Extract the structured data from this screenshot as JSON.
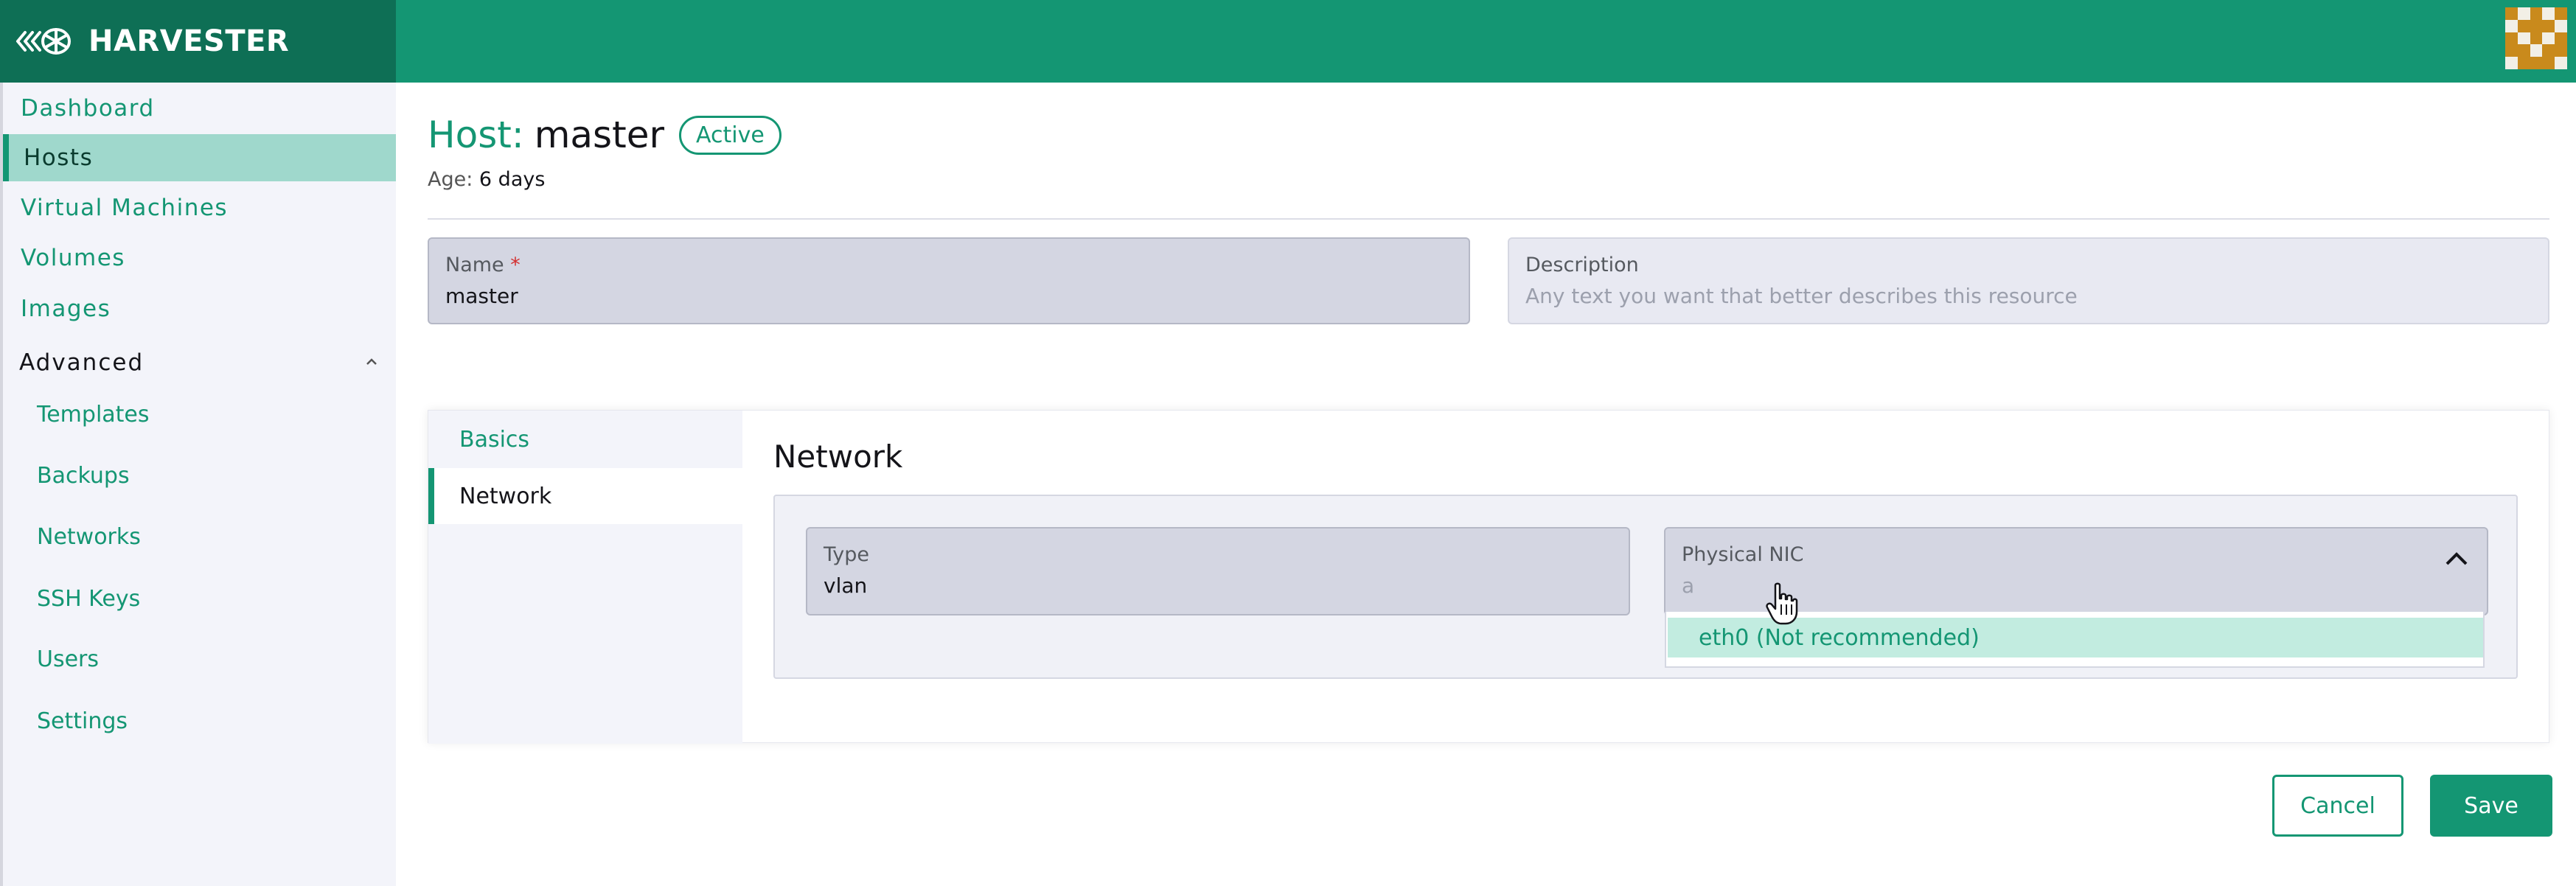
{
  "app": {
    "name": "HARVESTER"
  },
  "colors": {
    "brand": "#149673",
    "brand_dark": "#0e6f55",
    "active_nav": "#9fd8cc",
    "dropdown_highlight": "#c2ece0",
    "required": "#d32f2f"
  },
  "sidebar": {
    "items": [
      {
        "label": "Dashboard"
      },
      {
        "label": "Hosts",
        "active": true
      },
      {
        "label": "Virtual Machines"
      },
      {
        "label": "Volumes"
      },
      {
        "label": "Images"
      }
    ],
    "advanced": {
      "label": "Advanced",
      "icon": "chevron-up-icon",
      "items": [
        {
          "label": "Templates"
        },
        {
          "label": "Backups"
        },
        {
          "label": "Networks"
        },
        {
          "label": "SSH Keys"
        },
        {
          "label": "Users"
        },
        {
          "label": "Settings"
        }
      ]
    }
  },
  "page": {
    "title_prefix": "Host:",
    "title_name": "master",
    "status": "Active",
    "age_label": "Age:",
    "age_value": "6 days"
  },
  "form": {
    "name": {
      "label": "Name",
      "required_mark": "*",
      "value": "master"
    },
    "description": {
      "label": "Description",
      "placeholder": "Any text you want that better describes this resource"
    }
  },
  "tabs": [
    {
      "label": "Basics"
    },
    {
      "label": "Network",
      "active": true
    }
  ],
  "network": {
    "title": "Network",
    "type": {
      "label": "Type",
      "value": "vlan"
    },
    "physical_nic": {
      "label": "Physical NIC",
      "value": "a",
      "icon": "chevron-up-icon"
    },
    "options": [
      "eth0 (Not recommended)"
    ]
  },
  "actions": {
    "cancel_label": "Cancel",
    "save_label": "Save"
  }
}
